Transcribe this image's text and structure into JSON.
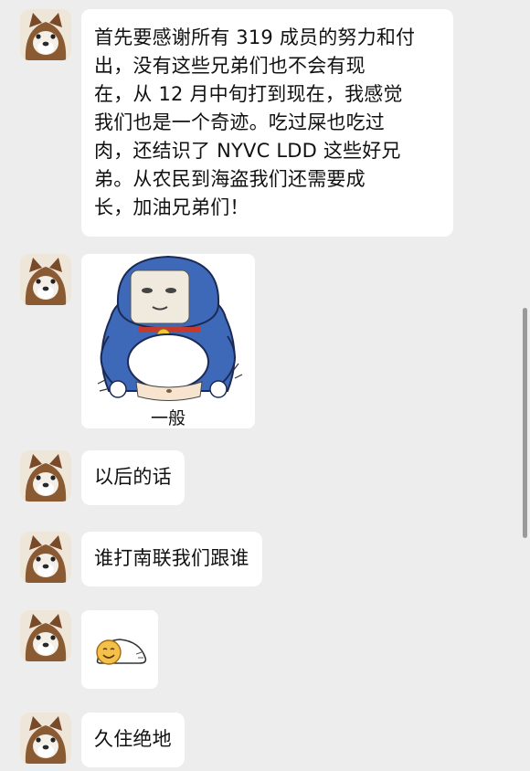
{
  "messages": [
    {
      "type": "text",
      "lines": [
        "首先要感谢所有 319 成员的努力和付",
        "出，没有这些兄弟们也不会有现",
        "在，从 12 月中旬打到现在，我感觉",
        "我们也是一个奇迹。吃过屎也吃过",
        "肉，还结识了 NYVC  LDD 这些好兄",
        "弟。从农民到海盗我们还需要成",
        "长，加油兄弟们！"
      ]
    },
    {
      "type": "sticker",
      "caption": "一般"
    },
    {
      "type": "text",
      "text": "以后的话"
    },
    {
      "type": "text",
      "text": "谁打南联我们跟谁"
    },
    {
      "type": "emoji",
      "icon": "smiling-blob-emoji"
    },
    {
      "type": "text",
      "text": "久住绝地"
    }
  ],
  "colors": {
    "background": "#ededed",
    "bubble": "#ffffff",
    "sticker_blue": "#3d69b8"
  }
}
